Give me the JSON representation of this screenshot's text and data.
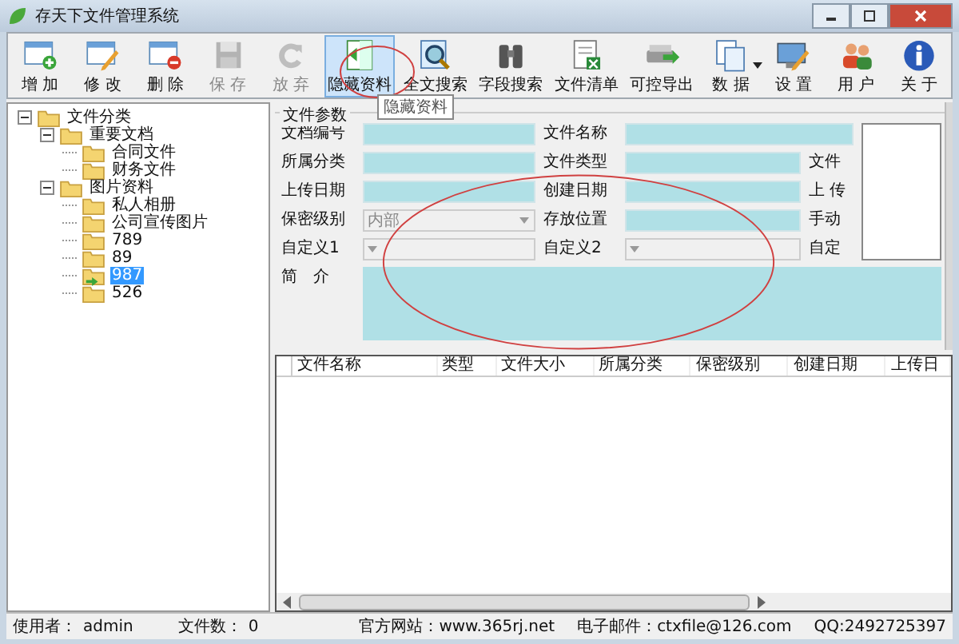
{
  "window": {
    "title": "存天下文件管理系统"
  },
  "toolbar": [
    {
      "label": "增 加",
      "disabled": false,
      "selected": false,
      "dropdown": false
    },
    {
      "label": "修 改",
      "disabled": false,
      "selected": false,
      "dropdown": false
    },
    {
      "label": "删 除",
      "disabled": false,
      "selected": false,
      "dropdown": false
    },
    {
      "label": "保 存",
      "disabled": true,
      "selected": false,
      "dropdown": false
    },
    {
      "label": "放 弃",
      "disabled": true,
      "selected": false,
      "dropdown": false
    },
    {
      "label": "隐藏资料",
      "disabled": false,
      "selected": true,
      "dropdown": false
    },
    {
      "label": "全文搜索",
      "disabled": false,
      "selected": false,
      "dropdown": false
    },
    {
      "label": "字段搜索",
      "disabled": false,
      "selected": false,
      "dropdown": false
    },
    {
      "label": "文件清单",
      "disabled": false,
      "selected": false,
      "dropdown": false
    },
    {
      "label": "可控导出",
      "disabled": false,
      "selected": false,
      "dropdown": false
    },
    {
      "label": "数 据",
      "disabled": false,
      "selected": false,
      "dropdown": true
    },
    {
      "label": "设 置",
      "disabled": false,
      "selected": false,
      "dropdown": false
    },
    {
      "label": "用 户",
      "disabled": false,
      "selected": false,
      "dropdown": false
    },
    {
      "label": "关 于",
      "disabled": false,
      "selected": false,
      "dropdown": false
    }
  ],
  "tooltip": "隐藏资料",
  "tree": [
    {
      "label": "文件分类",
      "kind": "folder",
      "selected": false,
      "expanded": true,
      "children": [
        {
          "label": "重要文档",
          "kind": "folder",
          "selected": false,
          "expanded": true,
          "children": [
            {
              "label": "合同文件",
              "kind": "folder",
              "selected": false
            },
            {
              "label": "财务文件",
              "kind": "folder",
              "selected": false
            }
          ]
        },
        {
          "label": "图片资料",
          "kind": "folder",
          "selected": false,
          "expanded": true,
          "children": [
            {
              "label": "私人相册",
              "kind": "folder",
              "selected": false
            },
            {
              "label": "公司宣传图片",
              "kind": "folder",
              "selected": false
            },
            {
              "label": "789",
              "kind": "folder",
              "selected": false
            },
            {
              "label": "89",
              "kind": "folder",
              "selected": false
            },
            {
              "label": "987",
              "kind": "linked",
              "selected": true
            },
            {
              "label": "526",
              "kind": "folder",
              "selected": false
            }
          ]
        }
      ]
    }
  ],
  "form": {
    "title": "文件参数",
    "rows": [
      {
        "label_1": "文档编号",
        "field_1": {
          "kind": "text"
        },
        "label_2": "文件名称",
        "field_2": {
          "kind": "text",
          "wide": true
        }
      },
      {
        "label_1": "所属分类",
        "field_1": {
          "kind": "text"
        },
        "label_2": "文件类型",
        "field_2": {
          "kind": "text",
          "wide": false
        },
        "label_3": "文件"
      },
      {
        "label_1": "上传日期",
        "field_1": {
          "kind": "text"
        },
        "label_2": "创建日期",
        "field_2": {
          "kind": "text",
          "wide": false
        },
        "label_3": "上 传"
      },
      {
        "label_1": "保密级别",
        "field_1": {
          "kind": "combo",
          "value": "内部"
        },
        "label_2": "存放位置",
        "field_2": {
          "kind": "text",
          "wide": false
        },
        "label_3": "手动"
      },
      {
        "label_1": "自定义1",
        "field_1": {
          "kind": "combo"
        },
        "label_2": "自定义2",
        "field_2": {
          "kind": "combo",
          "wide": false
        },
        "label_3": "自定"
      }
    ],
    "summary_label": "简　介"
  },
  "table": {
    "columns": [
      "文件名称",
      "类型",
      "文件大小",
      "所属分类",
      "保密级别",
      "创建日期",
      "上传日"
    ]
  },
  "status_bar": {
    "user_label": "使用者：",
    "user": "admin",
    "count_label": "文件数：",
    "count": "0",
    "website": "官方网站：www.365rj.net",
    "email": "电子邮件：ctxfile@126.com",
    "qq": "QQ:2492725397"
  }
}
